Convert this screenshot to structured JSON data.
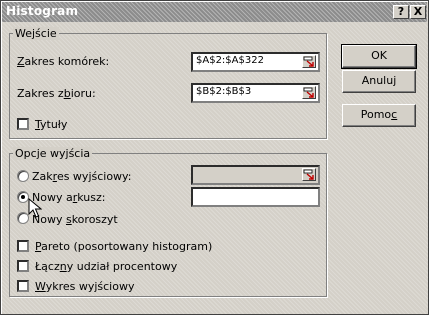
{
  "window": {
    "title": "Histogram",
    "help_label": "?",
    "close_label": "X"
  },
  "input_group": {
    "legend": "Wejście",
    "input_range": {
      "label_pre": "",
      "label_accel": "Z",
      "label_post": "akres komórek:",
      "value": "$A$2:$A$322"
    },
    "bin_range": {
      "label_pre": "Zakres z",
      "label_accel": "b",
      "label_post": "ioru:",
      "value": "$B$2:$B$3"
    },
    "labels_checkbox": {
      "label_pre": "",
      "label_accel": "T",
      "label_post": "ytuły",
      "checked": false
    }
  },
  "output_group": {
    "legend": "Opcje wyjścia",
    "output_range": {
      "label_pre": "Zak",
      "label_accel": "r",
      "label_post": "es wyjściowy:",
      "value": "",
      "selected": false
    },
    "new_sheet": {
      "label_pre": "Nowy a",
      "label_accel": "r",
      "label_post": "kusz:",
      "value": "",
      "selected": true
    },
    "new_workbook": {
      "label_pre": "Nowy ",
      "label_accel": "s",
      "label_post": "koroszyt",
      "selected": false
    },
    "pareto": {
      "label_pre": "",
      "label_accel": "P",
      "label_post": "areto (posortowany histogram)",
      "checked": false
    },
    "cumulative": {
      "label_pre": "Łącz",
      "label_accel": "n",
      "label_post": "y udział procentowy",
      "checked": false
    },
    "chart_output": {
      "label_pre": "",
      "label_accel": "W",
      "label_post": "ykres wyjściowy",
      "checked": false
    }
  },
  "buttons": {
    "ok": "OK",
    "cancel": "Anuluj",
    "help_pre": "Pomo",
    "help_accel": "c",
    "help_post": ""
  },
  "icons": {
    "collapse": "range-collapse-icon",
    "cursor": "mouse-pointer-icon"
  }
}
